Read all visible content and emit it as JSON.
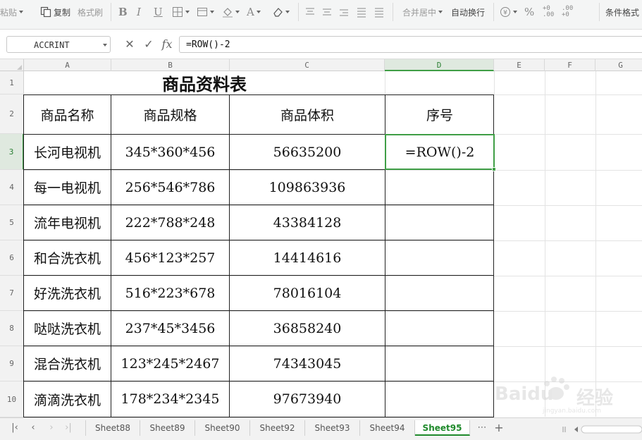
{
  "ribbon": {
    "paste": "粘贴",
    "copy": "复制",
    "format_painter": "格式刷",
    "merge_center": "合并居中",
    "wrap_text": "自动换行",
    "conditional_format": "条件格式"
  },
  "formula_bar": {
    "name_box": "ACCRINT",
    "cancel_glyph": "✕",
    "confirm_glyph": "✓",
    "fx_glyph": "fx",
    "formula": "=ROW()-2"
  },
  "grid": {
    "columns": [
      "A",
      "B",
      "C",
      "D",
      "E",
      "F",
      "G"
    ],
    "rows": [
      "1",
      "2",
      "3",
      "4",
      "5",
      "6",
      "7",
      "8",
      "9",
      "10"
    ],
    "active_cell": "D3",
    "title": "商品资料表",
    "headers": [
      "商品名称",
      "商品规格",
      "商品体积",
      "序号"
    ],
    "records": [
      {
        "name": "长河电视机",
        "spec": "345*360*456",
        "volume": "56635200",
        "seq": "=ROW()-2"
      },
      {
        "name": "每一电视机",
        "spec": "256*546*786",
        "volume": "109863936",
        "seq": ""
      },
      {
        "name": "流年电视机",
        "spec": "222*788*248",
        "volume": "43384128",
        "seq": ""
      },
      {
        "name": "和合洗衣机",
        "spec": "456*123*257",
        "volume": "14414616",
        "seq": ""
      },
      {
        "name": "好洗洗衣机",
        "spec": "516*223*678",
        "volume": "78016104",
        "seq": ""
      },
      {
        "name": "哒哒洗衣机",
        "spec": "237*45*3456",
        "volume": "36858240",
        "seq": ""
      },
      {
        "name": "混合洗衣机",
        "spec": "123*245*2467",
        "volume": "74343045",
        "seq": ""
      },
      {
        "name": "滴滴洗衣机",
        "spec": "178*234*2345",
        "volume": "97673940",
        "seq": ""
      }
    ]
  },
  "sheets": {
    "tabs": [
      "Sheet88",
      "Sheet89",
      "Sheet90",
      "Sheet92",
      "Sheet93",
      "Sheet94",
      "Sheet95"
    ],
    "active": "Sheet95",
    "more": "⋯",
    "add": "+"
  },
  "watermark": {
    "brand": "Baidu",
    "suffix": "经验",
    "url": "jingyan.baidu.com"
  },
  "colors": {
    "accent": "#3f9e46",
    "active_tab": "#1f8a2b",
    "grid_border": "#222222"
  }
}
